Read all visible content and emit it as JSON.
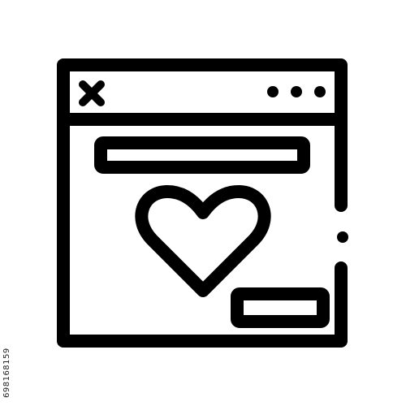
{
  "icon": {
    "name": "browser-window-with-heart-icon",
    "stroke_color": "#000000",
    "background_color": "#ffffff",
    "window": {
      "close_glyph": "close-icon",
      "menu_dots": 3
    },
    "content": {
      "heart_glyph": "heart-icon"
    }
  },
  "watermark": {
    "id_text": "698168159"
  }
}
